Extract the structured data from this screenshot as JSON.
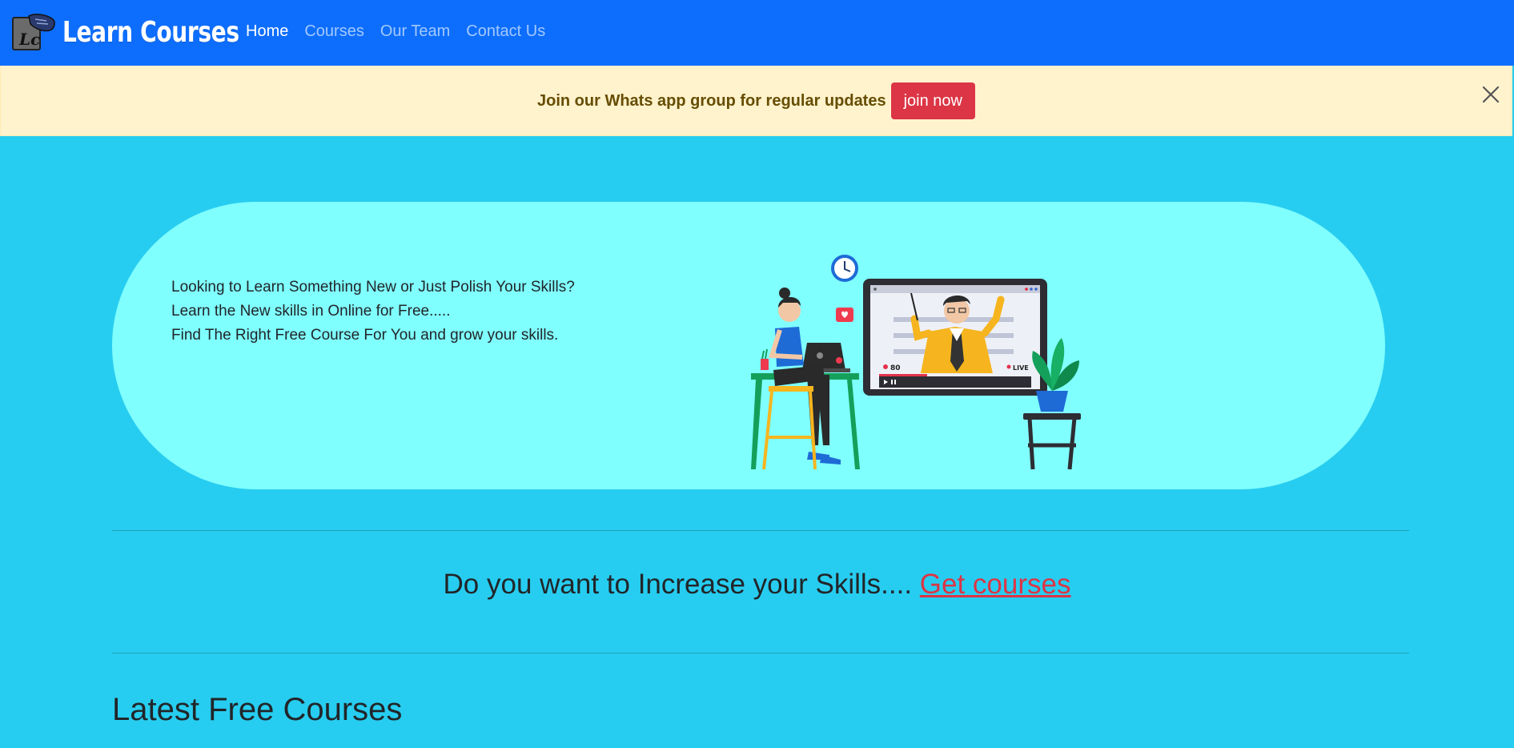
{
  "navbar": {
    "brand": "Learn Courses",
    "logo_letters": "Lc",
    "links": [
      {
        "label": "Home",
        "active": true
      },
      {
        "label": "Courses",
        "active": false
      },
      {
        "label": "Our Team",
        "active": false
      },
      {
        "label": "Contact Us",
        "active": false
      }
    ]
  },
  "alert": {
    "text": "Join our Whats app group for regular updates",
    "button": "join now"
  },
  "hero": {
    "lines": [
      "Looking to Learn Something New or Just Polish Your Skills?",
      "Learn the New skills in Online for Free.....",
      "Find The Right Free Course For You and grow your skills."
    ],
    "illustration": {
      "viewer_count": "80",
      "live_label": "LIVE"
    }
  },
  "cta": {
    "text": "Do you want to Increase your Skills.... ",
    "link": "Get courses"
  },
  "section_title": "Latest Free Courses",
  "colors": {
    "navbar": "#0d6efd",
    "page_bg": "#27cdf0",
    "hero_bg": "#80ffff",
    "alert_bg": "#fff3cd",
    "danger": "#dc3545"
  }
}
